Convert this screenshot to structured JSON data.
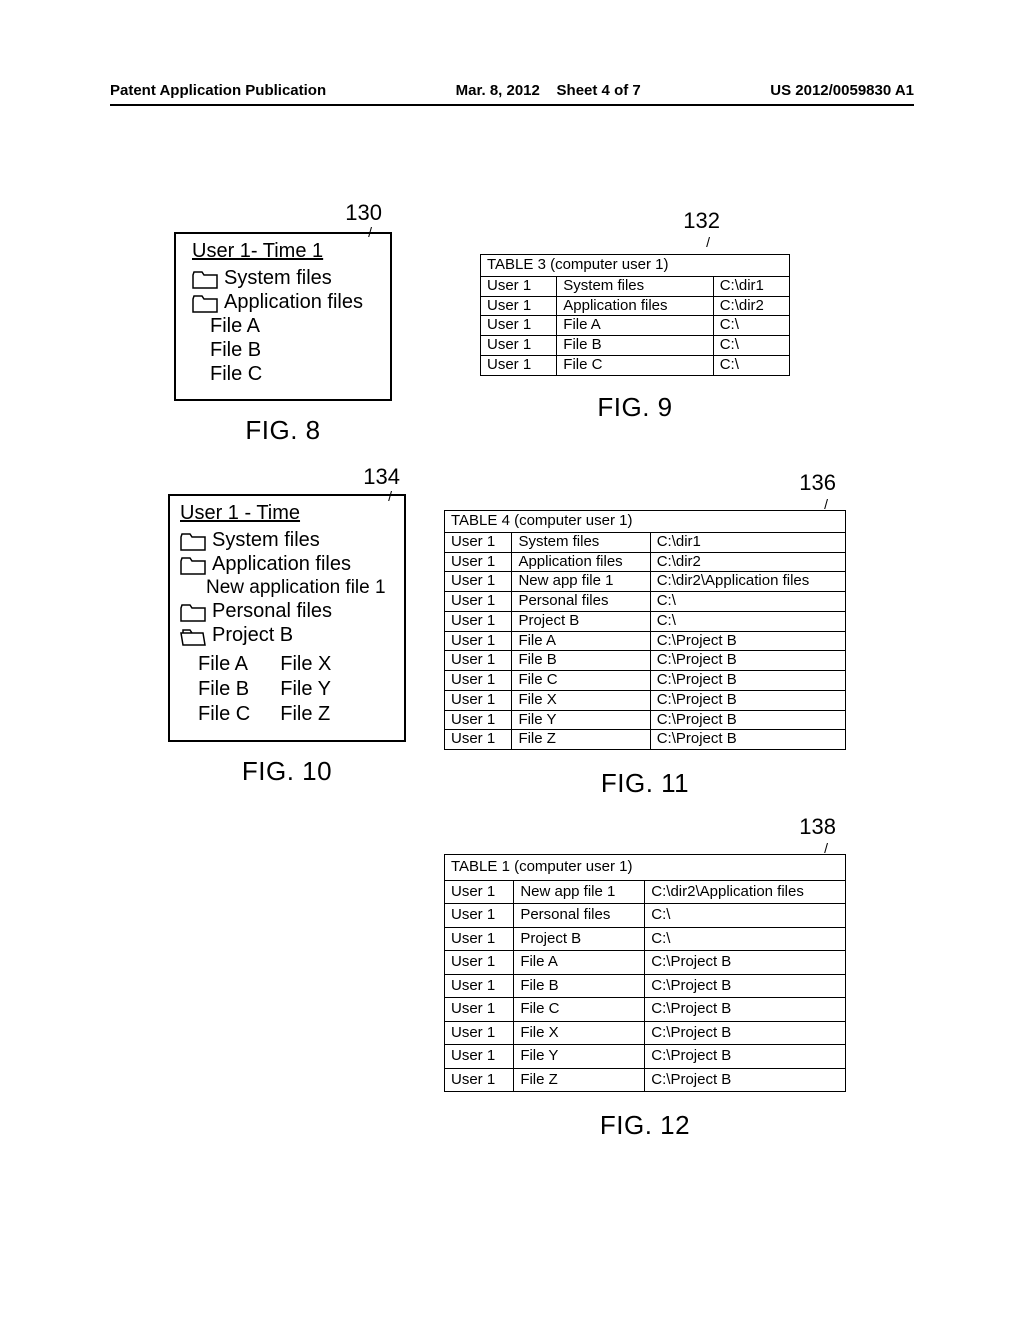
{
  "header": {
    "pub_label": "Patent Application Publication",
    "date": "Mar. 8, 2012",
    "sheet": "Sheet 4 of 7",
    "docnum": "US 2012/0059830 A1"
  },
  "fig8": {
    "ref": "130",
    "title": "User 1- Time 1",
    "folders": [
      "System files",
      "Application files"
    ],
    "files": [
      "File A",
      "File B",
      "File C"
    ],
    "caption": "FIG. 8"
  },
  "fig9": {
    "ref": "132",
    "table_title": "TABLE 3  (computer user 1)",
    "rows": [
      [
        "User 1",
        "System files",
        "C:\\dir1"
      ],
      [
        "User 1",
        "Application files",
        "C:\\dir2"
      ],
      [
        "User 1",
        "File A",
        "C:\\"
      ],
      [
        "User 1",
        "File B",
        "C:\\"
      ],
      [
        "User 1",
        "File C",
        "C:\\"
      ]
    ],
    "caption": "FIG. 9"
  },
  "fig10": {
    "ref": "134",
    "title": "User 1 - Time",
    "folders_top": [
      "System files",
      "Application files"
    ],
    "sub_app": "New application file 1",
    "folder_personal": "Personal files",
    "folder_project": "Project B",
    "col1": [
      "File A",
      "File B",
      "File C"
    ],
    "col2": [
      "File X",
      "File Y",
      "File Z"
    ],
    "caption": "FIG. 10"
  },
  "fig11": {
    "ref": "136",
    "table_title": "TABLE 4  (computer user 1)",
    "rows": [
      [
        "User 1",
        "System files",
        "C:\\dir1"
      ],
      [
        "User 1",
        "Application files",
        "C:\\dir2"
      ],
      [
        "User 1",
        "New app file 1",
        "C:\\dir2\\Application files"
      ],
      [
        "User 1",
        "Personal files",
        "C:\\"
      ],
      [
        "User 1",
        "Project B",
        "C:\\"
      ],
      [
        "User 1",
        "File A",
        "C:\\Project B"
      ],
      [
        "User 1",
        "File B",
        "C:\\Project B"
      ],
      [
        "User 1",
        "File C",
        "C:\\Project B"
      ],
      [
        "User 1",
        "File X",
        "C:\\Project B"
      ],
      [
        "User 1",
        "File Y",
        "C:\\Project B"
      ],
      [
        "User 1",
        "File Z",
        "C:\\Project B"
      ]
    ],
    "caption": "FIG. 11"
  },
  "fig12": {
    "ref": "138",
    "table_title": "TABLE 1  (computer user 1)",
    "rows": [
      [
        "User 1",
        "New app file 1",
        "C:\\dir2\\Application files"
      ],
      [
        "User 1",
        "Personal files",
        "C:\\"
      ],
      [
        "User 1",
        "Project B",
        "C:\\"
      ],
      [
        "User 1",
        "File A",
        "C:\\Project B"
      ],
      [
        "User 1",
        "File B",
        "C:\\Project B"
      ],
      [
        "User 1",
        "File C",
        "C:\\Project B"
      ],
      [
        "User 1",
        "File X",
        "C:\\Project B"
      ],
      [
        "User 1",
        "File Y",
        "C:\\Project B"
      ],
      [
        "User 1",
        "File Z",
        "C:\\Project B"
      ]
    ],
    "caption": "FIG. 12"
  }
}
